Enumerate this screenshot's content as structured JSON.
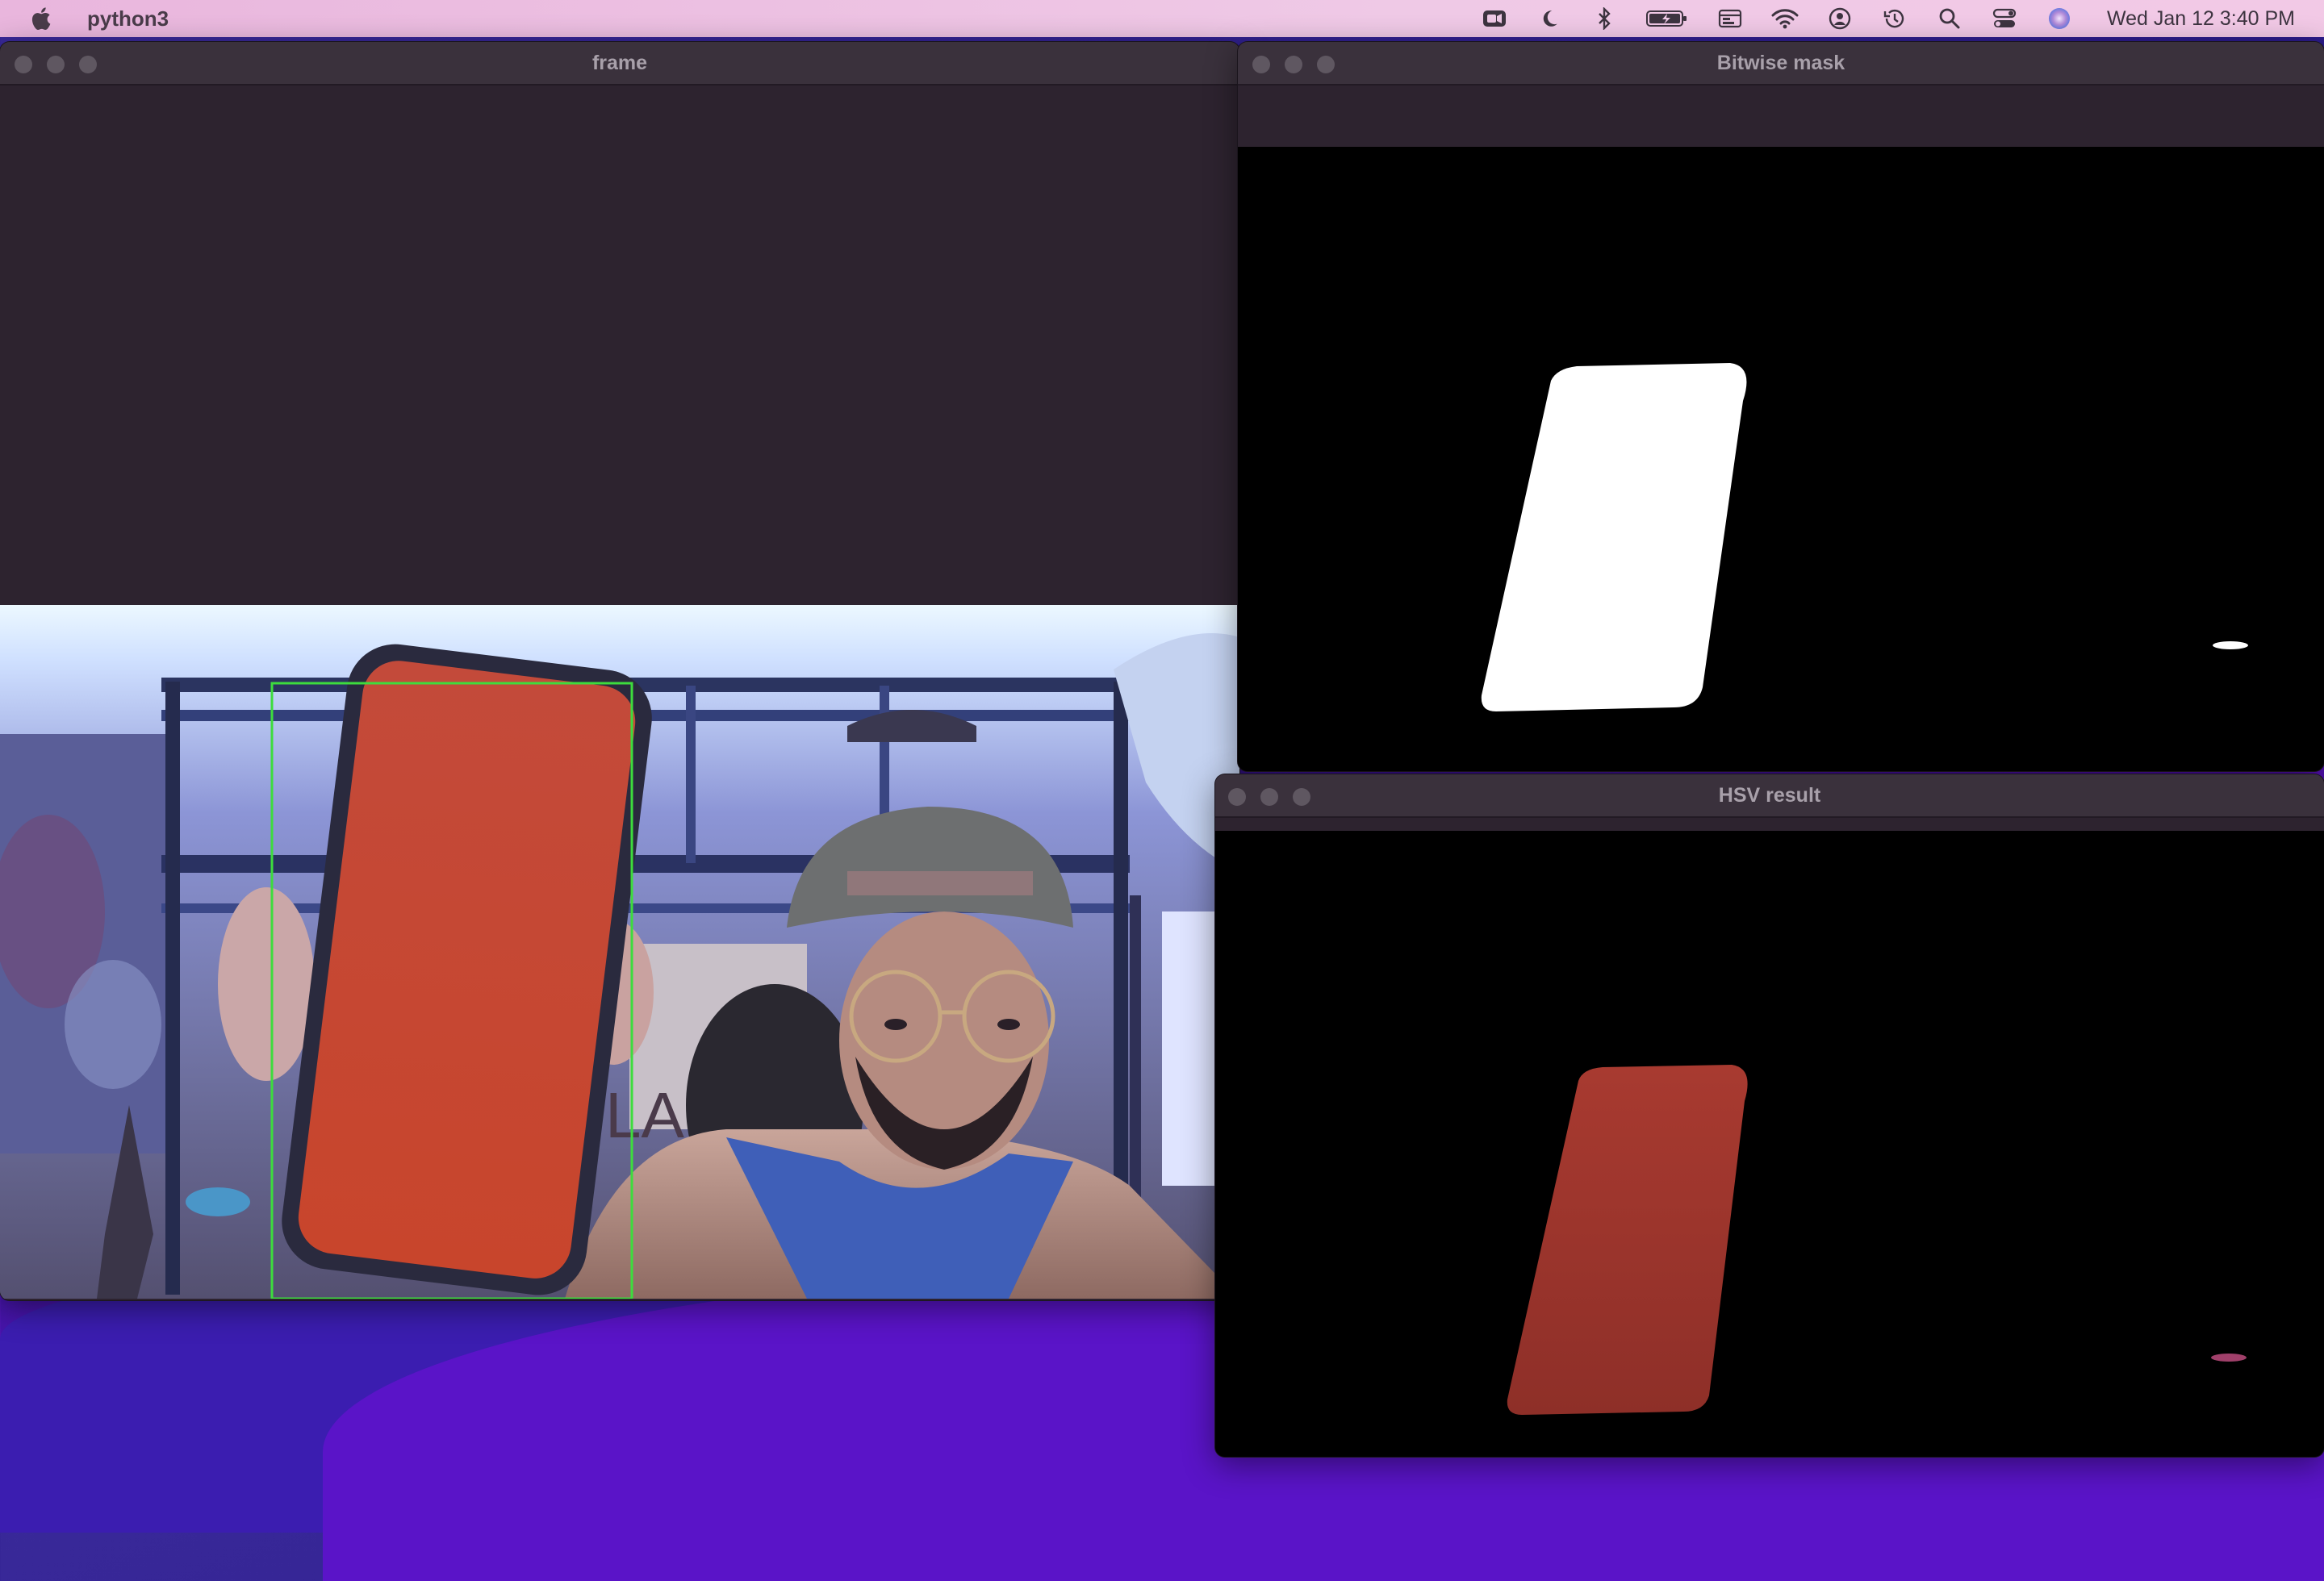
{
  "menubar": {
    "app_name": "python3",
    "datetime": "Wed Jan 12  3:40 PM",
    "icons": [
      "facetime-icon",
      "moon-icon",
      "bluetooth-icon",
      "battery-icon",
      "display-icon",
      "wifi-icon",
      "user-icon",
      "time-machine-icon",
      "search-icon",
      "control-center-icon",
      "siri-icon"
    ]
  },
  "windows": {
    "frame": {
      "title": "frame"
    },
    "mask": {
      "title": "Bitwise mask"
    },
    "hsv": {
      "title": "HSV result"
    }
  },
  "colors": {
    "detection_box": "#3ddc3d",
    "mask_blob": "#ffffff",
    "hsv_blob": "#a8322c",
    "phone_screen": "#c8412f"
  }
}
